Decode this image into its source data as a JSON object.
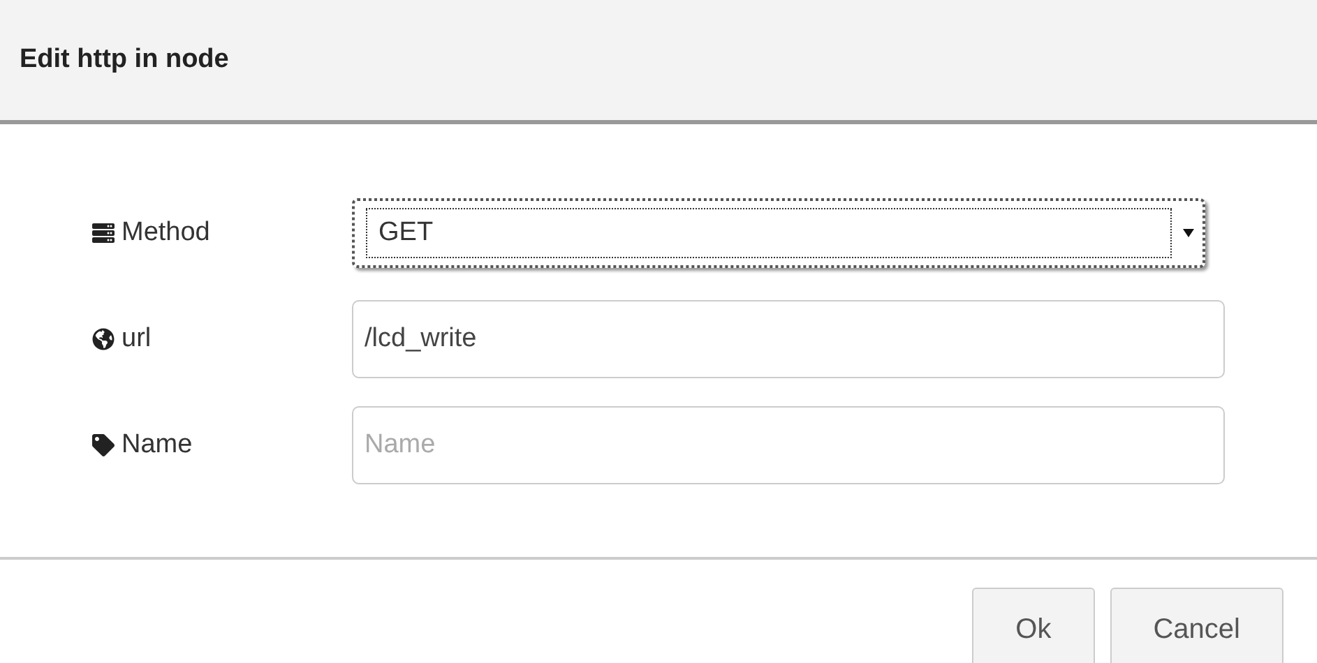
{
  "dialog": {
    "title": "Edit http in node"
  },
  "fields": [
    {
      "kind": "select",
      "label": "Method",
      "value": "GET",
      "focused": true
    },
    {
      "kind": "text",
      "label": "url",
      "value": "/lcd_write"
    },
    {
      "kind": "text",
      "label": "Name",
      "placeholder": "Name"
    }
  ],
  "buttons": [
    "Ok",
    "Cancel"
  ]
}
